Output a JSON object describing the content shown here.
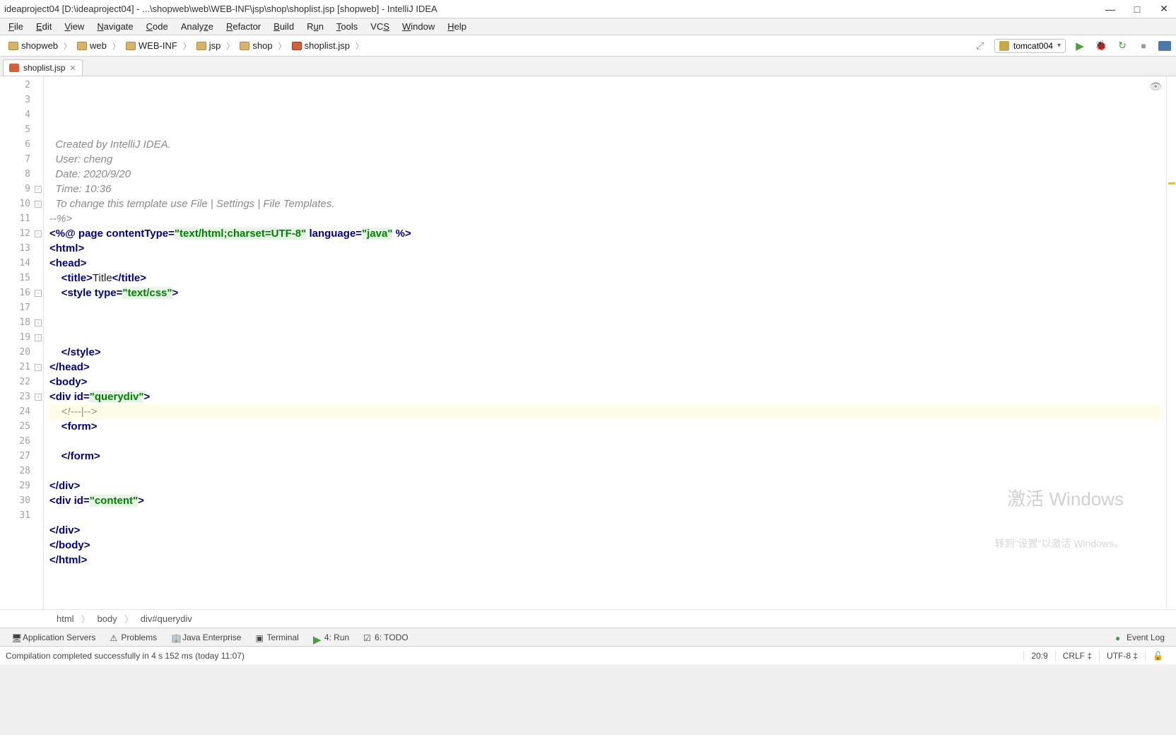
{
  "window": {
    "title": "ideaproject04 [D:\\ideaproject04] - ...\\shopweb\\web\\WEB-INF\\jsp\\shop\\shoplist.jsp [shopweb] - IntelliJ IDEA"
  },
  "menu": {
    "items": [
      "File",
      "Edit",
      "View",
      "Navigate",
      "Code",
      "Analyze",
      "Refactor",
      "Build",
      "Run",
      "Tools",
      "VCS",
      "Window",
      "Help"
    ]
  },
  "breadcrumbs": {
    "items": [
      "shopweb",
      "web",
      "WEB-INF",
      "jsp",
      "shop",
      "shoplist.jsp"
    ]
  },
  "runconfig": {
    "name": "tomcat004"
  },
  "tabs": {
    "items": [
      {
        "label": "shoplist.jsp"
      }
    ]
  },
  "code": {
    "lines": [
      {
        "n": 2,
        "indent": "  ",
        "segs": [
          {
            "cls": "c-comment",
            "t": "Created by IntelliJ IDEA."
          }
        ]
      },
      {
        "n": 3,
        "indent": "  ",
        "segs": [
          {
            "cls": "c-comment",
            "t": "User: cheng"
          }
        ]
      },
      {
        "n": 4,
        "indent": "  ",
        "segs": [
          {
            "cls": "c-comment",
            "t": "Date: 2020/9/20"
          }
        ]
      },
      {
        "n": 5,
        "indent": "  ",
        "segs": [
          {
            "cls": "c-comment",
            "t": "Time: 10:36"
          }
        ]
      },
      {
        "n": 6,
        "indent": "  ",
        "segs": [
          {
            "cls": "c-comment",
            "t": "To change this template use File | Settings | File Templates."
          }
        ]
      },
      {
        "n": 7,
        "indent": "",
        "segs": [
          {
            "cls": "c-comment",
            "t": "--%>"
          }
        ]
      },
      {
        "n": 8,
        "indent": "",
        "segs": [
          {
            "cls": "c-ang",
            "t": "<%@ "
          },
          {
            "cls": "c-key",
            "t": "page "
          },
          {
            "cls": "c-attr",
            "t": "contentType"
          },
          {
            "cls": "c-ang",
            "t": "="
          },
          {
            "cls": "c-str c-strbg",
            "t": "\"text/html;charset=UTF-8\""
          },
          {
            "cls": "c-ang",
            "t": " "
          },
          {
            "cls": "c-attr",
            "t": "language"
          },
          {
            "cls": "c-ang",
            "t": "="
          },
          {
            "cls": "c-str c-strbg",
            "t": "\"java\""
          },
          {
            "cls": "c-ang",
            "t": " %>"
          }
        ]
      },
      {
        "n": 9,
        "indent": "",
        "fold": "-",
        "segs": [
          {
            "cls": "c-ang",
            "t": "<"
          },
          {
            "cls": "c-tag",
            "t": "html"
          },
          {
            "cls": "c-ang",
            "t": ">"
          }
        ]
      },
      {
        "n": 10,
        "indent": "",
        "fold": "-",
        "segs": [
          {
            "cls": "c-ang",
            "t": "<"
          },
          {
            "cls": "c-tag",
            "t": "head"
          },
          {
            "cls": "c-ang",
            "t": ">"
          }
        ]
      },
      {
        "n": 11,
        "indent": "    ",
        "segs": [
          {
            "cls": "c-ang",
            "t": "<"
          },
          {
            "cls": "c-tag",
            "t": "title"
          },
          {
            "cls": "c-ang",
            "t": ">"
          },
          {
            "cls": "c-txt",
            "t": "Title"
          },
          {
            "cls": "c-ang",
            "t": "</"
          },
          {
            "cls": "c-tag",
            "t": "title"
          },
          {
            "cls": "c-ang",
            "t": ">"
          }
        ]
      },
      {
        "n": 12,
        "indent": "    ",
        "fold": "-",
        "segs": [
          {
            "cls": "c-ang",
            "t": "<"
          },
          {
            "cls": "c-tag",
            "t": "style "
          },
          {
            "cls": "c-attr",
            "t": "type"
          },
          {
            "cls": "c-ang",
            "t": "="
          },
          {
            "cls": "c-str c-strbg",
            "t": "\"text/css\""
          },
          {
            "cls": "c-ang",
            "t": ">"
          }
        ]
      },
      {
        "n": 13,
        "indent": "",
        "segs": []
      },
      {
        "n": 14,
        "indent": "",
        "segs": []
      },
      {
        "n": 15,
        "indent": "",
        "segs": []
      },
      {
        "n": 16,
        "indent": "    ",
        "fold": "-",
        "segs": [
          {
            "cls": "c-ang",
            "t": "</"
          },
          {
            "cls": "c-tag",
            "t": "style"
          },
          {
            "cls": "c-ang",
            "t": ">"
          }
        ]
      },
      {
        "n": 17,
        "indent": "",
        "segs": [
          {
            "cls": "c-ang",
            "t": "</"
          },
          {
            "cls": "c-tag",
            "t": "head"
          },
          {
            "cls": "c-ang",
            "t": ">"
          }
        ]
      },
      {
        "n": 18,
        "indent": "",
        "fold": "-",
        "segs": [
          {
            "cls": "c-ang",
            "t": "<"
          },
          {
            "cls": "c-tag",
            "t": "body"
          },
          {
            "cls": "c-ang",
            "t": ">"
          }
        ]
      },
      {
        "n": 19,
        "indent": "",
        "fold": "-",
        "segs": [
          {
            "cls": "c-ang",
            "t": "<"
          },
          {
            "cls": "c-tag",
            "t": "div "
          },
          {
            "cls": "c-attr",
            "t": "id"
          },
          {
            "cls": "c-ang",
            "t": "="
          },
          {
            "cls": "c-str c-strbg",
            "t": "\"querydiv\""
          },
          {
            "cls": "c-ang",
            "t": ">"
          }
        ]
      },
      {
        "n": 20,
        "indent": "    ",
        "current": true,
        "segs": [
          {
            "cls": "c-comment",
            "t": "<!---|-->"
          }
        ]
      },
      {
        "n": 21,
        "indent": "    ",
        "fold": "-",
        "segs": [
          {
            "cls": "c-ang",
            "t": "<"
          },
          {
            "cls": "c-tag",
            "t": "form"
          },
          {
            "cls": "c-ang",
            "t": ">"
          }
        ]
      },
      {
        "n": 22,
        "indent": "",
        "segs": []
      },
      {
        "n": 23,
        "indent": "    ",
        "fold": "-",
        "segs": [
          {
            "cls": "c-ang",
            "t": "</"
          },
          {
            "cls": "c-tag",
            "t": "form"
          },
          {
            "cls": "c-ang",
            "t": ">"
          }
        ]
      },
      {
        "n": 24,
        "indent": "",
        "segs": []
      },
      {
        "n": 25,
        "indent": "",
        "segs": [
          {
            "cls": "c-ang",
            "t": "</"
          },
          {
            "cls": "c-tag",
            "t": "div"
          },
          {
            "cls": "c-ang",
            "t": ">"
          }
        ]
      },
      {
        "n": 26,
        "indent": "",
        "segs": [
          {
            "cls": "c-ang",
            "t": "<"
          },
          {
            "cls": "c-tag",
            "t": "div "
          },
          {
            "cls": "c-attr",
            "t": "id"
          },
          {
            "cls": "c-ang",
            "t": "="
          },
          {
            "cls": "c-str c-strbg",
            "t": "\"content\""
          },
          {
            "cls": "c-ang",
            "t": ">"
          }
        ]
      },
      {
        "n": 27,
        "indent": "",
        "segs": []
      },
      {
        "n": 28,
        "indent": "",
        "segs": [
          {
            "cls": "c-ang",
            "t": "</"
          },
          {
            "cls": "c-tag",
            "t": "div"
          },
          {
            "cls": "c-ang",
            "t": ">"
          }
        ]
      },
      {
        "n": 29,
        "indent": "",
        "segs": [
          {
            "cls": "c-ang",
            "t": "</"
          },
          {
            "cls": "c-tag",
            "t": "body"
          },
          {
            "cls": "c-ang",
            "t": ">"
          }
        ]
      },
      {
        "n": 30,
        "indent": "",
        "segs": [
          {
            "cls": "c-ang",
            "t": "</"
          },
          {
            "cls": "c-tag",
            "t": "html"
          },
          {
            "cls": "c-ang",
            "t": ">"
          }
        ]
      },
      {
        "n": 31,
        "indent": "",
        "segs": []
      }
    ]
  },
  "crumbpath": {
    "items": [
      "html",
      "body",
      "div#querydiv"
    ]
  },
  "toolwins": {
    "left": [
      {
        "label": "Application Servers"
      },
      {
        "label": "Problems"
      },
      {
        "label": "Java Enterprise"
      },
      {
        "label": "Terminal"
      },
      {
        "label": "4: Run"
      },
      {
        "label": "6: TODO"
      }
    ],
    "right": [
      {
        "label": "Event Log"
      }
    ]
  },
  "status": {
    "msg": "Compilation completed successfully in 4 s 152 ms (today 11:07)",
    "pos": "20:9",
    "eol": "CRLF",
    "enc": "UTF-8"
  },
  "watermark": {
    "line1": "激活 Windows",
    "line2": "转到\"设置\"以激活 Windows。"
  }
}
